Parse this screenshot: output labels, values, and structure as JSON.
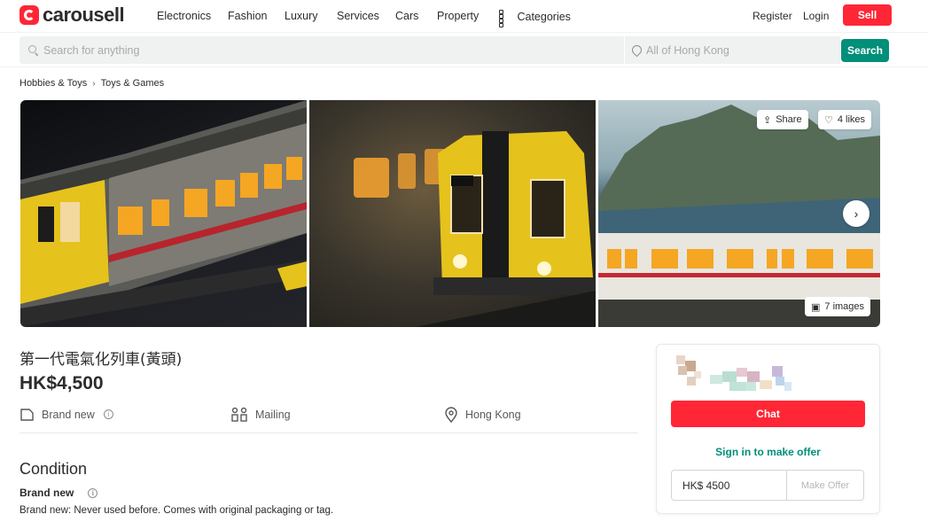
{
  "app": {
    "logo_text": "carousell",
    "brand_color": "#ff2636",
    "accent_color": "#008f79"
  },
  "nav": {
    "links": [
      "Electronics",
      "Fashion",
      "Luxury",
      "Services",
      "Cars",
      "Property"
    ],
    "categories_label": "Categories",
    "register_label": "Register",
    "login_label": "Login",
    "sell_label": "Sell"
  },
  "search": {
    "placeholder": "Search for anything",
    "location_placeholder": "All of Hong Kong",
    "button_label": "Search"
  },
  "breadcrumb": [
    "Hobbies & Toys",
    "Toys & Games"
  ],
  "gallery": {
    "share_label": "Share",
    "likes_label": "4 likes",
    "images_label": "7 images"
  },
  "listing": {
    "title": "第一代電氣化列車(黃頭)",
    "price": "HK$4,500",
    "condition_attr": "Brand new",
    "delivery_attr": "Mailing",
    "location_attr": "Hong Kong"
  },
  "condition": {
    "heading": "Condition",
    "value": "Brand new",
    "description": "Brand new: Never used before. Comes with original packaging or tag."
  },
  "seller_card": {
    "chat_label": "Chat",
    "signin_label": "Sign in to make offer",
    "offer_value": "HK$ 4500",
    "make_offer_label": "Make Offer"
  }
}
